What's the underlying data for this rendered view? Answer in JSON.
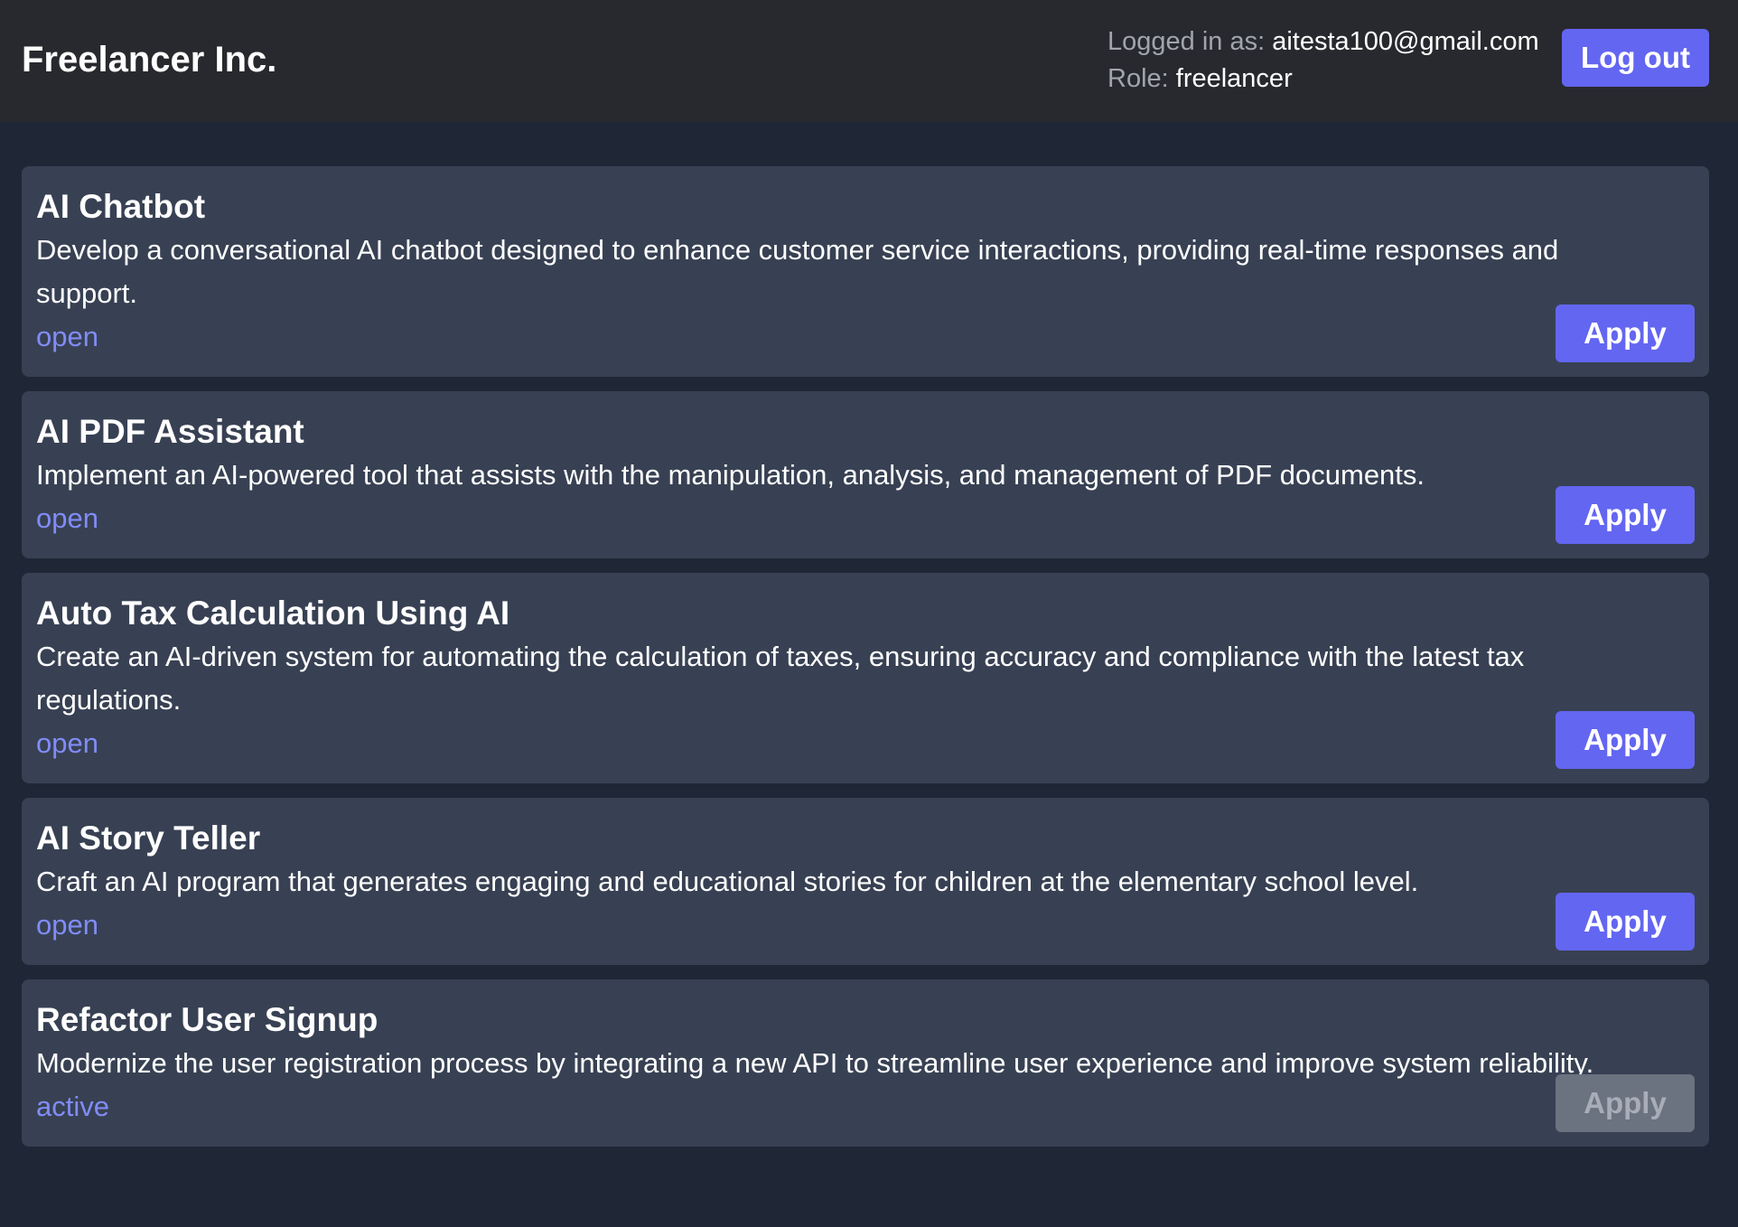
{
  "header": {
    "brand": "Freelancer Inc.",
    "logged_in_label": "Logged in as:",
    "logged_in_value": "aitesta100@gmail.com",
    "role_label": "Role:",
    "role_value": "freelancer",
    "logout_label": "Log out"
  },
  "projects": [
    {
      "title": "AI Chatbot",
      "description": "Develop a conversational AI chatbot designed to enhance customer service interactions, providing real-time responses and support.",
      "status": "open",
      "apply_label": "Apply",
      "apply_enabled": true
    },
    {
      "title": "AI PDF Assistant",
      "description": "Implement an AI-powered tool that assists with the manipulation, analysis, and management of PDF documents.",
      "status": "open",
      "apply_label": "Apply",
      "apply_enabled": true
    },
    {
      "title": "Auto Tax Calculation Using AI",
      "description": "Create an AI-driven system for automating the calculation of taxes, ensuring accuracy and compliance with the latest tax regulations.",
      "status": "open",
      "apply_label": "Apply",
      "apply_enabled": true
    },
    {
      "title": "AI Story Teller",
      "description": "Craft an AI program that generates engaging and educational stories for children at the elementary school level.",
      "status": "open",
      "apply_label": "Apply",
      "apply_enabled": true
    },
    {
      "title": "Refactor User Signup",
      "description": "Modernize the user registration process by integrating a new API to streamline user experience and improve system reliability.",
      "status": "active",
      "apply_label": "Apply",
      "apply_enabled": false
    }
  ],
  "colors": {
    "accent": "#6366f1",
    "status_text": "#818cf8",
    "card_bg": "#384153",
    "page_bg": "#1f2736",
    "header_bg": "#28292e",
    "disabled_button": "#6b7280"
  }
}
